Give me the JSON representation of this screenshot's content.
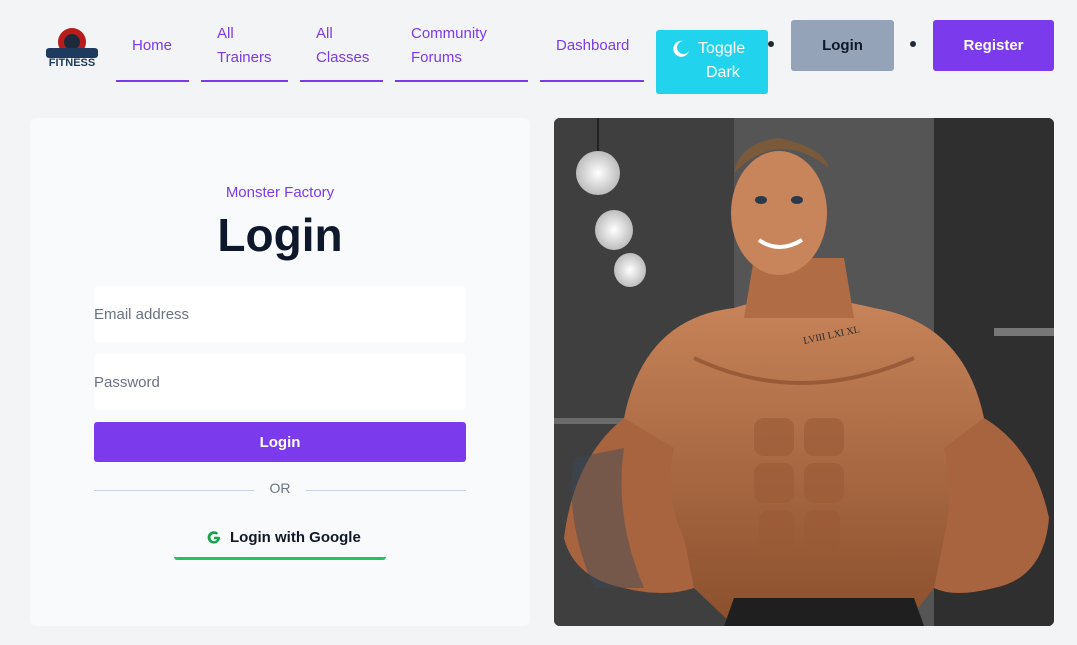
{
  "nav": {
    "logo_text": "FITNESS",
    "links": [
      {
        "line1": "Home",
        "line2": ""
      },
      {
        "line1": "All",
        "line2": "Trainers"
      },
      {
        "line1": "All",
        "line2": "Classes"
      },
      {
        "line1": "Community",
        "line2": "Forums"
      },
      {
        "line1": "Dashboard",
        "line2": ""
      }
    ],
    "toggle_line1": "Toggle",
    "toggle_line2": "Dark",
    "login_label": "Login",
    "register_label": "Register"
  },
  "login_card": {
    "brand": "Monster Factory",
    "title": "Login",
    "email_placeholder": "Email address",
    "password_placeholder": "Password",
    "submit_label": "Login",
    "or_text": "OR",
    "google_label": "Login with Google"
  },
  "hero": {
    "tattoo_text": "LVIII LXI XL"
  },
  "colors": {
    "accent": "#7c3aed",
    "toggle": "#22d3ee",
    "google_underline": "#22c55e",
    "secondary_button": "#94a3b8"
  }
}
